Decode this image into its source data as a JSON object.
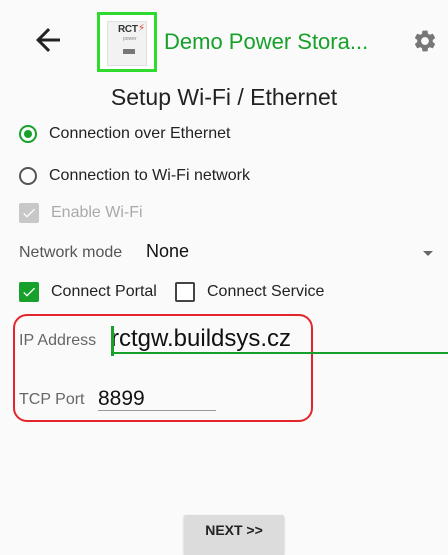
{
  "header": {
    "title": "Demo Power Stora...",
    "logo_text": "RCT",
    "logo_subtext": "power",
    "back_icon": "arrow-left-icon",
    "settings_icon": "gear-icon"
  },
  "page": {
    "title": "Setup Wi-Fi / Ethernet"
  },
  "connection": {
    "options": [
      {
        "label": "Connection over Ethernet",
        "selected": true
      },
      {
        "label": "Connection to Wi-Fi network",
        "selected": false
      }
    ],
    "enable_wifi": {
      "label": "Enable Wi-Fi",
      "checked": true,
      "disabled": true
    }
  },
  "network_mode": {
    "label": "Network mode",
    "value": "None"
  },
  "connect": {
    "portal": {
      "label": "Connect Portal",
      "checked": true
    },
    "service": {
      "label": "Connect Service",
      "checked": false
    }
  },
  "fields": {
    "ip_address": {
      "label": "IP Address",
      "value": "rctgw.buildsys.cz"
    },
    "tcp_port": {
      "label": "TCP Port",
      "value": "8899"
    }
  },
  "actions": {
    "next_label": "NEXT >>"
  },
  "colors": {
    "accent": "#17a12a",
    "highlight": "#e4262c",
    "logo_border": "#2edc2e"
  }
}
